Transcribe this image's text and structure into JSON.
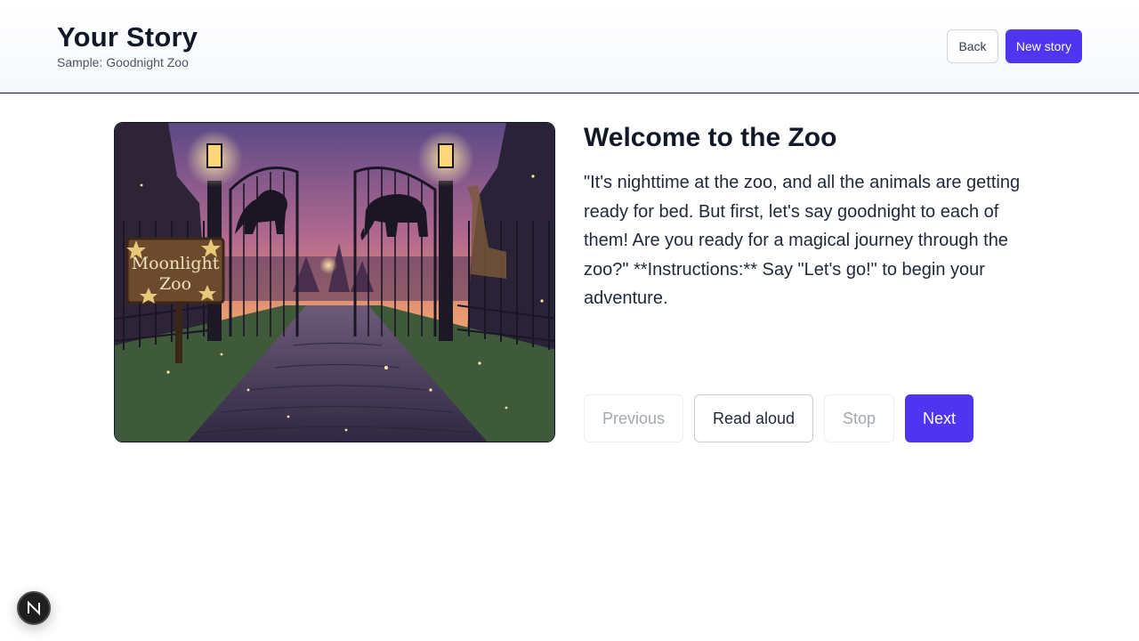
{
  "header": {
    "title": "Your Story",
    "subtitle": "Sample: Goodnight Zoo",
    "back_label": "Back",
    "new_story_label": "New story"
  },
  "illustration": {
    "sign_line1": "Moonlight",
    "sign_line2": "Zoo",
    "icons": [
      "lion-silhouette",
      "elephant-silhouette",
      "giraffe-silhouette",
      "lantern"
    ]
  },
  "page": {
    "heading": "Welcome to the Zoo",
    "text": "\"It's nighttime at the zoo, and all the animals are getting ready for bed. But first, let's say goodnight to each of them! Are you ready for a magical journey through the zoo?\" **Instructions:** Say \"Let's go!\" to begin your adventure."
  },
  "controls": {
    "previous_label": "Previous",
    "read_aloud_label": "Read aloud",
    "stop_label": "Stop",
    "next_label": "Next"
  },
  "colors": {
    "accent": "#4f35f0",
    "heading": "#111827",
    "disabled_text": "#a3a8b1"
  },
  "dev_badge": {
    "letter": "N"
  }
}
